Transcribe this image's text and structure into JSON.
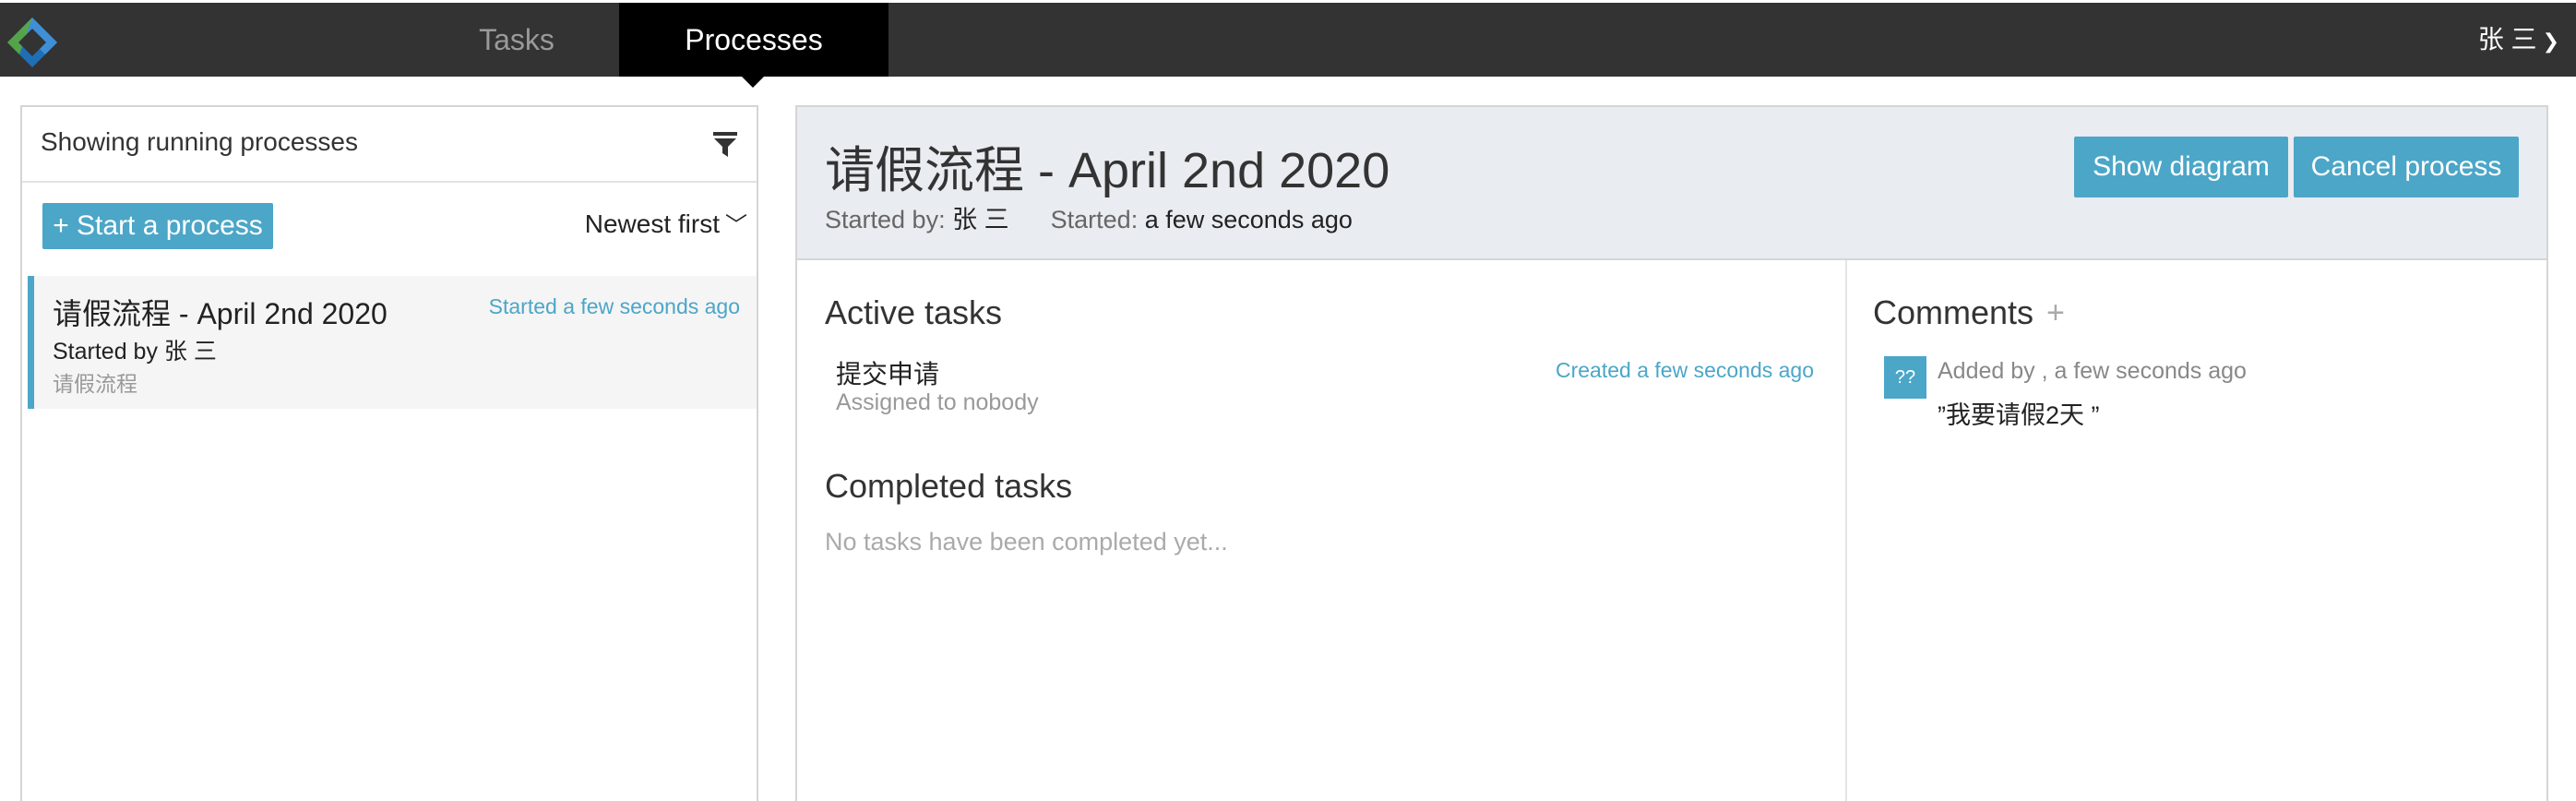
{
  "navbar": {
    "tabs": [
      {
        "label": "Tasks",
        "active": false
      },
      {
        "label": "Processes",
        "active": true
      }
    ],
    "user": "张 三"
  },
  "sidebar": {
    "header": "Showing running processes",
    "start_button": "+ Start a process",
    "sort_label": "Newest first",
    "items": [
      {
        "name": "请假流程 - April 2nd 2020",
        "started_when": "Started a few seconds ago",
        "started_by": "Started by 张 三",
        "definition": "请假流程"
      }
    ]
  },
  "detail": {
    "title": "请假流程 - April 2nd 2020",
    "started_by_label": "Started by:",
    "started_by": "张 三",
    "started_label": "Started:",
    "started": "a few seconds ago",
    "show_diagram": "Show diagram",
    "cancel_process": "Cancel process",
    "active_tasks_title": "Active tasks",
    "active_tasks": [
      {
        "name": "提交申请",
        "assignee": "Assigned to nobody",
        "created": "Created a few seconds ago"
      }
    ],
    "completed_tasks_title": "Completed tasks",
    "completed_empty": "No tasks have been completed yet...",
    "comments_title": "Comments",
    "comments_add": "+",
    "comments": [
      {
        "avatar": "??",
        "meta": "Added by , a few seconds ago",
        "text": "”我要请假2天 ”"
      }
    ]
  },
  "colors": {
    "accent": "#4ba6c8",
    "navbar": "#333333",
    "active_tab": "#000000",
    "header_bg": "#e9ecf0"
  }
}
